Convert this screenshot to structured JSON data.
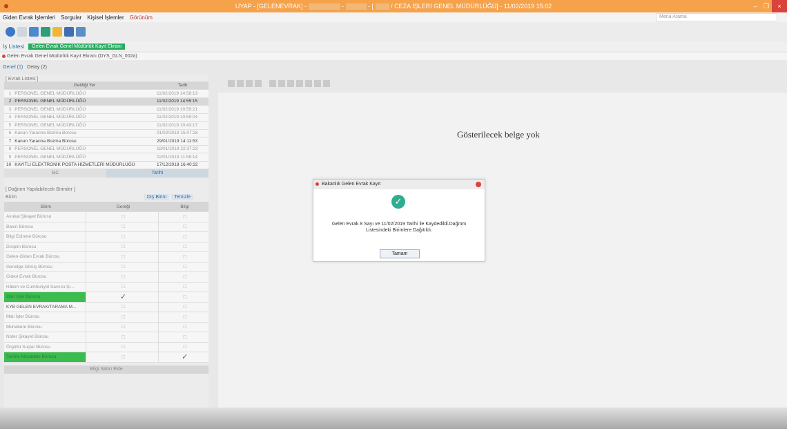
{
  "window": {
    "title_prefix": "UYAP - [GELENEVRAK] -",
    "title_suffix": "/ CEZA İŞLERİ GENEL MÜDÜRLÜĞÜ] - 11/02/2019 15:02",
    "minimize": "–",
    "maximize": "❐",
    "close": "×"
  },
  "menu": {
    "items": [
      "Giden Evrak İşlemleri",
      "Sorgular",
      "Kişisel İşlemler",
      "Görünüm"
    ],
    "search_placeholder": "Menu Arama"
  },
  "tabs": {
    "work_list": "İş Listesi",
    "active_tab": "Gelen Evrak Genel Müdürlük Kayıt Ekranı"
  },
  "screen": {
    "title": "Gelen Evrak Genel Müdürlük Kayıt Ekranı (DYS_GLN_002a)",
    "subtabs": [
      "Genel (1)",
      "Detay (2)"
    ]
  },
  "evrak_listesi": {
    "label": "[ Evrak Listesi ]",
    "columns": [
      "Geldiği Yer",
      "Tarih"
    ],
    "rows": [
      {
        "no": "1",
        "place": "PERSONEL GENEL MÜDÜRLÜĞÜ",
        "date": "11/02/2019 14:58:13"
      },
      {
        "no": "2",
        "place": "PERSONEL GENEL MÜDÜRLÜĞÜ",
        "date": "11/02/2019 14:55:15"
      },
      {
        "no": "3",
        "place": "PERSONEL GENEL MÜDÜRLÜĞÜ",
        "date": "11/02/2019 10:59:21"
      },
      {
        "no": "4",
        "place": "PERSONEL GENEL MÜDÜRLÜĞÜ",
        "date": "11/02/2019 10:59:04"
      },
      {
        "no": "5",
        "place": "PERSONEL GENEL MÜDÜRLÜĞÜ",
        "date": "11/02/2019 10:43:17"
      },
      {
        "no": "6",
        "place": "Kanun Yararına Bozma Bürosu",
        "date": "01/02/2019 15:07:28"
      },
      {
        "no": "7",
        "place": "Kanun Yararına Bozma Bürosu",
        "date": "29/01/2019 14:11:53"
      },
      {
        "no": "8",
        "place": "PERSONEL GENEL MÜDÜRLÜĞÜ",
        "date": "18/01/2019 22:37:23"
      },
      {
        "no": "9",
        "place": "PERSONEL GENEL MÜDÜRLÜĞÜ",
        "date": "02/01/2019 11:58:14"
      },
      {
        "no": "10",
        "place": "KAYITLI ELEKTRONİK POSTA HİZMETLERİ MÜDÜRLÜĞÜ",
        "date": "17/12/2018 16:40:32"
      }
    ],
    "sort_left": "GC",
    "sort_right": "Tarihi"
  },
  "dagitim": {
    "label": "[ Dağıtım Yapılabilecek Birimler ]",
    "birim_label": "Birim",
    "dis_birim": "Dış Birim",
    "temizle": "Temizle",
    "columns": [
      "Birim",
      "Gereği",
      "Bilgi"
    ],
    "rows": [
      {
        "name": "Avukat Şikayet Bürosu",
        "geregi": "☐",
        "bilgi": "☐"
      },
      {
        "name": "Basın Bürosu",
        "geregi": "☐",
        "bilgi": "☐"
      },
      {
        "name": "Bilgi Edinme Bürosu",
        "geregi": "☐",
        "bilgi": "☐"
      },
      {
        "name": "Disiplin Bürosu",
        "geregi": "☐",
        "bilgi": "☐"
      },
      {
        "name": "Gelen-Giden Evrak Bürosu",
        "geregi": "☐",
        "bilgi": "☐"
      },
      {
        "name": "Genelge-Görüş Bürosu",
        "geregi": "☐",
        "bilgi": "☐"
      },
      {
        "name": "Giden Evrak Bürosu",
        "geregi": "☐",
        "bilgi": "☐"
      },
      {
        "name": "Hâkim ve Cumhuriyet Savcısı Şi...",
        "geregi": "☐",
        "bilgi": "☐"
      },
      {
        "name": "İdari İşler Bürosu",
        "geregi": "✓",
        "bilgi": "☐"
      },
      {
        "name": "KYB GELEN EVRAK/TARAMA M...",
        "geregi": "☐",
        "bilgi": "☐"
      },
      {
        "name": "Mali İşler Bürosu",
        "geregi": "☐",
        "bilgi": "☐"
      },
      {
        "name": "Muhabere Bürosu",
        "geregi": "☐",
        "bilgi": "☐"
      },
      {
        "name": "Noter Şikayet Bürosu",
        "geregi": "☐",
        "bilgi": "☐"
      },
      {
        "name": "Örgütlü Suçlar Bürosu",
        "geregi": "☐",
        "bilgi": "☐"
      },
      {
        "name": "Terörle Mücadele Bürosu",
        "geregi": "☐",
        "bilgi": "✓"
      }
    ],
    "bottom": "Bilgi Satırı Ekle"
  },
  "viewer": {
    "empty_text": "Gösterilecek belge yok"
  },
  "dialog": {
    "title": "Bakanlık Gelen Evrak Kayıt",
    "message_line1": "Gelen Evrak 8 Sayı ve 11/02/2019 Tarihi ile Kaydedildi.Dağıtım",
    "message_line2": "Listesindeki Birimlere Dağıtıldı.",
    "ok_label": "Tamam",
    "success_icon": "✓"
  }
}
